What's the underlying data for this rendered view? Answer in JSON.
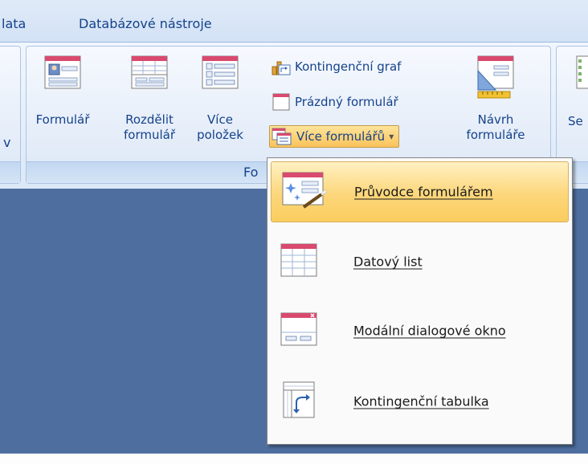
{
  "tabs": {
    "partial_tab": "lata",
    "database_tools": "Databázové nástroje"
  },
  "ribbon": {
    "group_label": "Fo",
    "left_cut_char": "v",
    "buttons": {
      "form": "Formulář",
      "split_form_line1": "Rozdělit",
      "split_form_line2": "formulář",
      "multiple_items_line1": "Více",
      "multiple_items_line2": "položek",
      "pivot_chart": "Kontingenční graf",
      "blank_form": "Prázdný formulář",
      "more_forms": "Více formulářů",
      "more_forms_arrow": "▾",
      "form_design_line1": "Návrh",
      "form_design_line2": "formuláře",
      "partial_right": "Se"
    }
  },
  "menu": {
    "items": [
      {
        "label": "Průvodce formulářem",
        "icon": "form-wizard-icon"
      },
      {
        "label": "Datový list",
        "icon": "datasheet-icon"
      },
      {
        "label": "Modální dialogové okno",
        "icon": "modal-dialog-icon"
      },
      {
        "label": "Kontingenční tabulka",
        "icon": "pivot-table-icon"
      }
    ]
  },
  "colors": {
    "ribbon_text": "#15428b",
    "workspace": "#4e6e9f",
    "highlight": "#fcd67a"
  }
}
